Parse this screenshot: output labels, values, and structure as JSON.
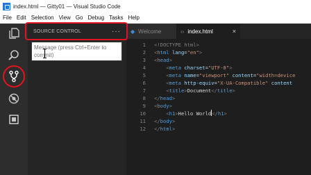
{
  "window": {
    "title": "index.html — Gitty01 — Visual Studio Code"
  },
  "menu": [
    "File",
    "Edit",
    "Selection",
    "View",
    "Go",
    "Debug",
    "Tasks",
    "Help"
  ],
  "activity_bar": {
    "items": [
      {
        "name": "explorer",
        "icon": "files-icon"
      },
      {
        "name": "search",
        "icon": "search-icon"
      },
      {
        "name": "source-control",
        "icon": "source-control-icon",
        "active": true
      },
      {
        "name": "debug",
        "icon": "debug-icon"
      },
      {
        "name": "extensions",
        "icon": "extensions-icon"
      }
    ]
  },
  "sidebar": {
    "header": "SOURCE CONTROL",
    "more": "···",
    "commit_placeholder": "Message (press Ctrl+Enter to commit)"
  },
  "tabs": [
    {
      "label": "Welcome",
      "icon": "vscode-icon",
      "active": false
    },
    {
      "label": "index.html",
      "icon": "html-icon",
      "active": true,
      "close": "×"
    }
  ],
  "editor": {
    "lines": [
      {
        "n": "1",
        "parts": [
          [
            "punct",
            "<!DOCTYPE html>"
          ]
        ]
      },
      {
        "n": "2",
        "parts": [
          [
            "punct",
            "<"
          ],
          [
            "tag",
            "html"
          ],
          [
            "txt",
            " "
          ],
          [
            "attr",
            "lang"
          ],
          [
            "txt",
            "="
          ],
          [
            "str",
            "\"en\""
          ],
          [
            "punct",
            ">"
          ]
        ]
      },
      {
        "n": "3",
        "parts": [
          [
            "punct",
            "<"
          ],
          [
            "tag",
            "head"
          ],
          [
            "punct",
            ">"
          ]
        ]
      },
      {
        "n": "4",
        "parts": [
          [
            "txt",
            "    "
          ],
          [
            "punct",
            "<"
          ],
          [
            "tag",
            "meta"
          ],
          [
            "txt",
            " "
          ],
          [
            "attr",
            "charset"
          ],
          [
            "txt",
            "="
          ],
          [
            "str",
            "\"UTF-8\""
          ],
          [
            "punct",
            ">"
          ]
        ]
      },
      {
        "n": "5",
        "parts": [
          [
            "txt",
            "    "
          ],
          [
            "punct",
            "<"
          ],
          [
            "tag",
            "meta"
          ],
          [
            "txt",
            " "
          ],
          [
            "attr",
            "name"
          ],
          [
            "txt",
            "="
          ],
          [
            "str",
            "\"viewport\""
          ],
          [
            "txt",
            " "
          ],
          [
            "attr",
            "content"
          ],
          [
            "txt",
            "="
          ],
          [
            "str",
            "\"width=device"
          ]
        ]
      },
      {
        "n": "6",
        "parts": [
          [
            "txt",
            "    "
          ],
          [
            "punct",
            "<"
          ],
          [
            "tag",
            "meta"
          ],
          [
            "txt",
            " "
          ],
          [
            "attr",
            "http-equiv"
          ],
          [
            "txt",
            "="
          ],
          [
            "str",
            "\"X-UA-Compatible\""
          ],
          [
            "txt",
            " "
          ],
          [
            "attr",
            "content"
          ]
        ]
      },
      {
        "n": "7",
        "parts": [
          [
            "txt",
            "    "
          ],
          [
            "punct",
            "<"
          ],
          [
            "tag",
            "title"
          ],
          [
            "punct",
            ">"
          ],
          [
            "txt",
            "Document"
          ],
          [
            "punct",
            "</"
          ],
          [
            "tag",
            "title"
          ],
          [
            "punct",
            ">"
          ]
        ]
      },
      {
        "n": "8",
        "parts": [
          [
            "punct",
            "</"
          ],
          [
            "tag",
            "head"
          ],
          [
            "punct",
            ">"
          ]
        ]
      },
      {
        "n": "9",
        "parts": [
          [
            "punct",
            "<"
          ],
          [
            "tag",
            "body"
          ],
          [
            "punct",
            ">"
          ]
        ]
      },
      {
        "n": "10",
        "parts": [
          [
            "txt",
            "    "
          ],
          [
            "punct",
            "<"
          ],
          [
            "tag",
            "h1"
          ],
          [
            "punct",
            ">"
          ],
          [
            "txt",
            "Hello World"
          ],
          [
            "caret",
            ""
          ],
          [
            "punct",
            "</"
          ],
          [
            "tag",
            "h1"
          ],
          [
            "punct",
            ">"
          ]
        ]
      },
      {
        "n": "11",
        "parts": [
          [
            "punct",
            "</"
          ],
          [
            "tag",
            "body"
          ],
          [
            "punct",
            ">"
          ]
        ]
      },
      {
        "n": "12",
        "parts": [
          [
            "punct",
            "</"
          ],
          [
            "tag",
            "html"
          ],
          [
            "punct",
            ">"
          ]
        ]
      }
    ]
  },
  "colors": {
    "annotation": "#e0141e",
    "accent": "#1f7ad4",
    "tag": "#569cd6",
    "attr": "#9cdcfe",
    "string": "#ce9178"
  }
}
